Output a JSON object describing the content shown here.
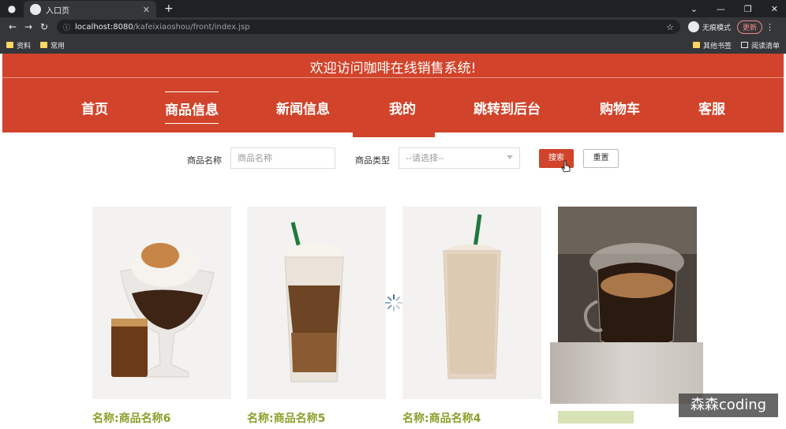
{
  "browser": {
    "tab_title": "入口页",
    "new_tab": "+",
    "url_host": "localhost:8080",
    "url_path": "/kafeixiaoshou/front/index.jsp",
    "incognito_label": "无痕模式",
    "update_label": "更新",
    "bookmarks": [
      "资料",
      "常用"
    ],
    "bookmarks_right": [
      "其他书签",
      "阅读清单"
    ]
  },
  "header": {
    "welcome": "欢迎访问咖啡在线销售系统!",
    "nav": [
      "首页",
      "商品信息",
      "新闻信息",
      "我的",
      "跳转到后台",
      "购物车",
      "客服"
    ],
    "active_index": 1
  },
  "search": {
    "name_label": "商品名称",
    "name_placeholder": "商品名称",
    "type_label": "商品类型",
    "type_value": "--请选择--",
    "search_button": "搜索",
    "reset_button": "重置"
  },
  "products": [
    {
      "name": "名称:商品名称6"
    },
    {
      "name": "名称:商品名称5"
    },
    {
      "name": "名称:商品名称4"
    }
  ],
  "watermark": "森森coding",
  "colors": {
    "brand": "#d1432a",
    "product_name": "#8aa02b"
  }
}
